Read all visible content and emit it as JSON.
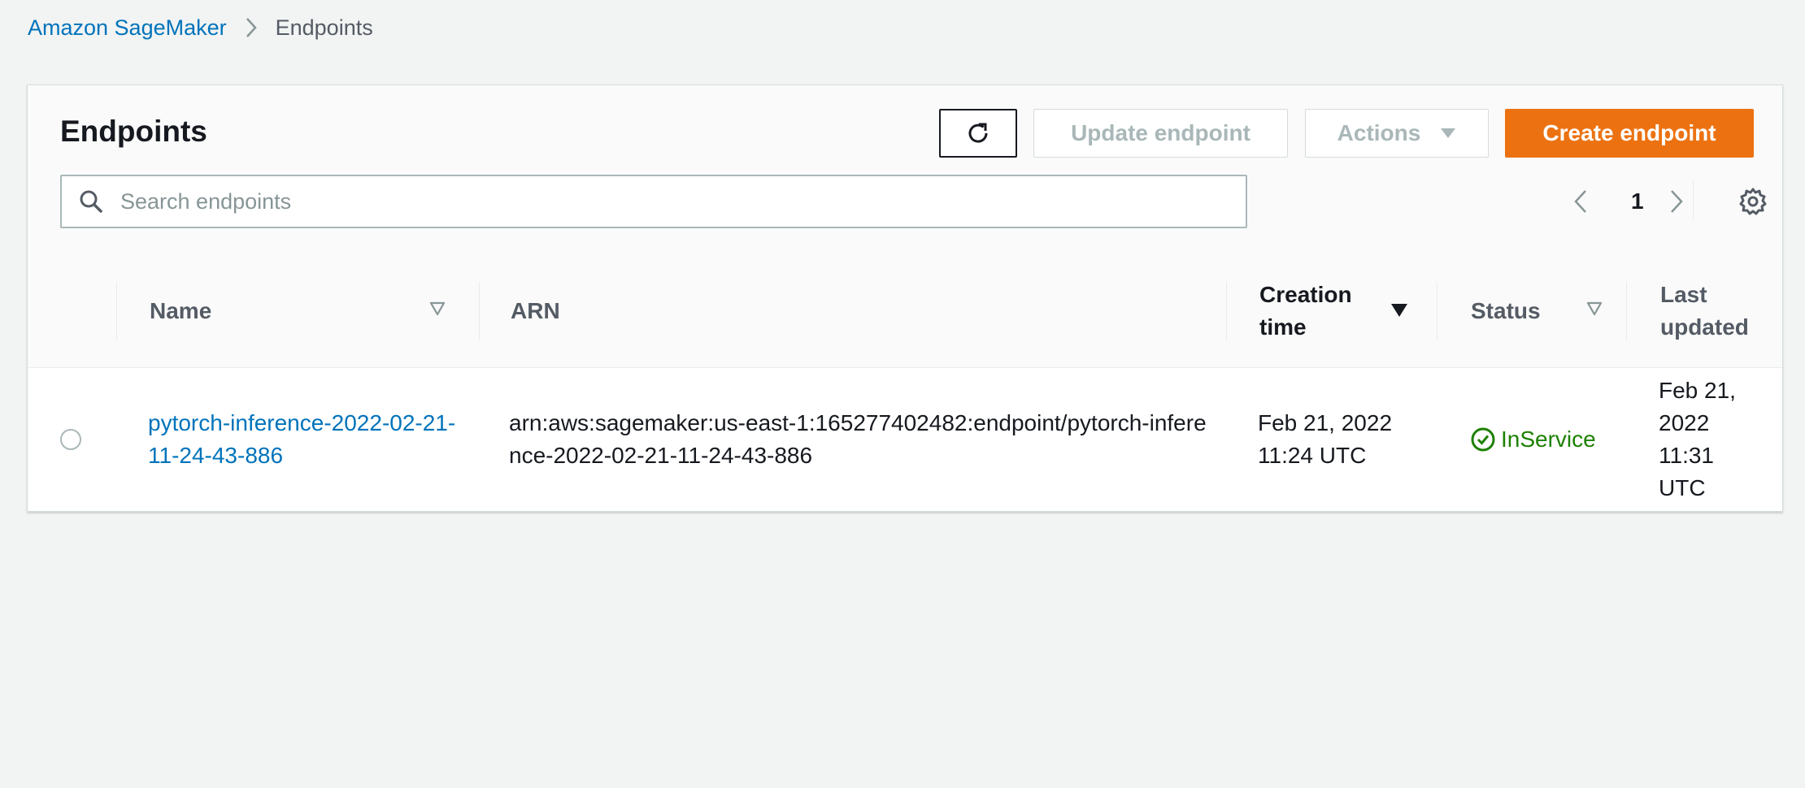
{
  "breadcrumb": {
    "parent": "Amazon SageMaker",
    "current": "Endpoints"
  },
  "panel": {
    "title": "Endpoints",
    "buttons": {
      "refresh_icon": "refresh-icon",
      "update": "Update endpoint",
      "actions": "Actions",
      "create": "Create endpoint"
    },
    "search": {
      "placeholder": "Search endpoints",
      "value": ""
    },
    "pagination": {
      "current_page": "1"
    }
  },
  "table": {
    "columns": [
      {
        "label": "Name",
        "sort": "sortable"
      },
      {
        "label": "ARN",
        "sort": "none"
      },
      {
        "label": "Creation time",
        "sort": "descending"
      },
      {
        "label": "Status",
        "sort": "sortable"
      },
      {
        "label": "Last updated",
        "sort": "none"
      }
    ],
    "rows": [
      {
        "selected": false,
        "name": "pytorch-inference-2022-02-21-11-24-43-886",
        "arn": "arn:aws:sagemaker:us-east-1:165277402482:endpoint/pytorch-inference-2022-02-21-11-24-43-886",
        "creation_time": "Feb 21, 2022 11:24 UTC",
        "status": "InService",
        "last_updated": "Feb 21, 2022 11:31 UTC"
      }
    ]
  },
  "colors": {
    "link": "#0073bb",
    "primary_button": "#ec7211",
    "status_success": "#1d8102",
    "disabled_text": "#aab7b8",
    "background": "#f2f3f3"
  }
}
